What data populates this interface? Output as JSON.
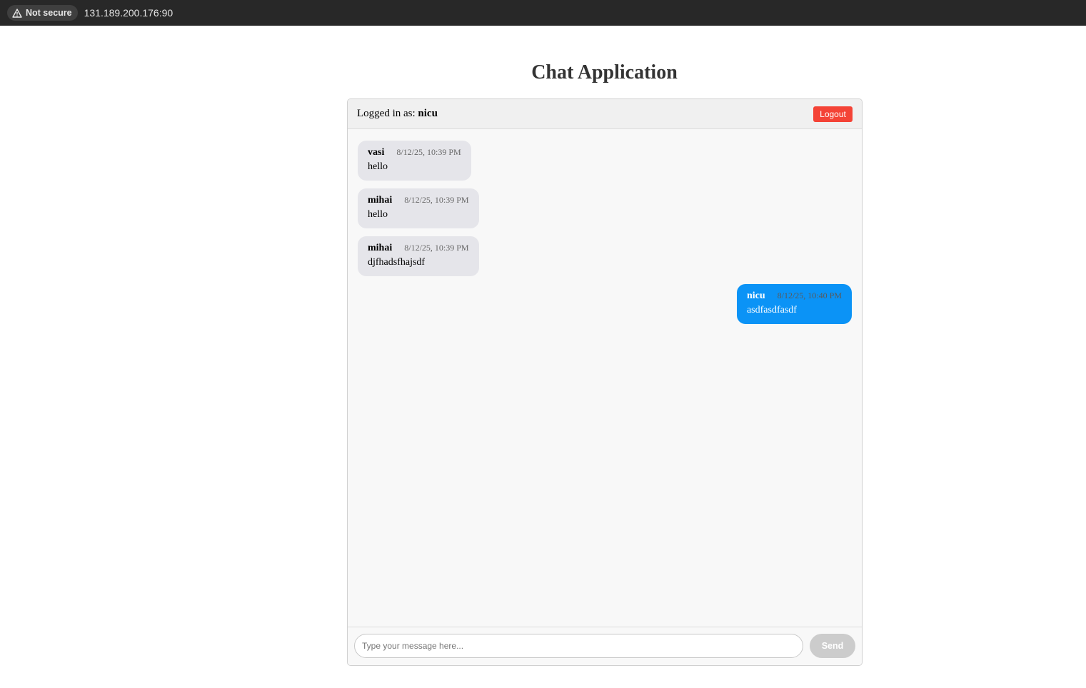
{
  "browser": {
    "security_label": "Not secure",
    "security_icon": "warning-triangle-icon",
    "url": "131.189.200.176:90"
  },
  "page": {
    "title": "Chat Application"
  },
  "header": {
    "logged_in_prefix": "Logged in as:",
    "username": "nicu",
    "logout_label": "Logout"
  },
  "messages": [
    {
      "user": "vasi",
      "time": "8/12/25, 10:39 PM",
      "text": "hello",
      "mine": false
    },
    {
      "user": "mihai",
      "time": "8/12/25, 10:39 PM",
      "text": "hello",
      "mine": false
    },
    {
      "user": "mihai",
      "time": "8/12/25, 10:39 PM",
      "text": "djfhadsfhajsdf",
      "mine": false
    },
    {
      "user": "nicu",
      "time": "8/12/25, 10:40 PM",
      "text": "asdfasdfasdf",
      "mine": true
    }
  ],
  "composer": {
    "placeholder": "Type your message here...",
    "value": "",
    "send_label": "Send"
  },
  "colors": {
    "logout": "#f44336",
    "own_bubble": "#0b93f6",
    "other_bubble": "#e5e5ea",
    "send_disabled": "#cccccc"
  }
}
